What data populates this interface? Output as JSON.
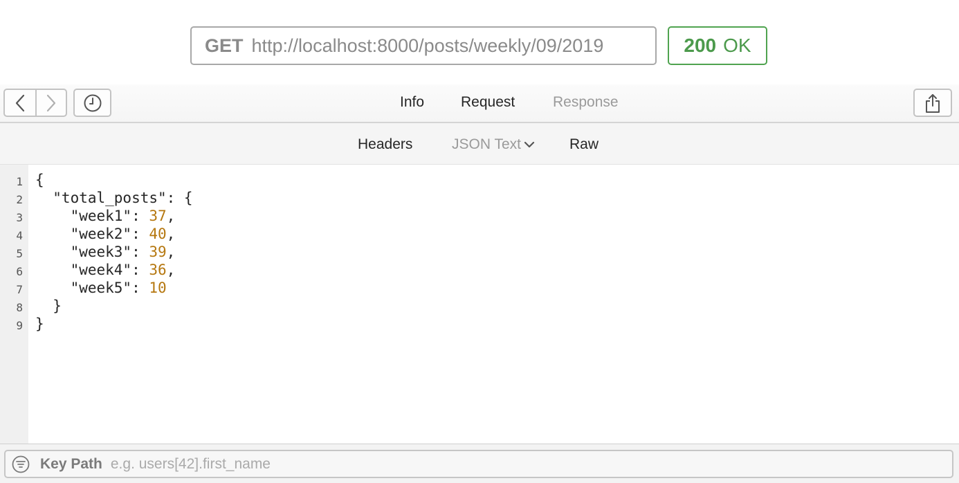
{
  "request": {
    "method": "GET",
    "url": "http://localhost:8000/posts/weekly/09/2019"
  },
  "status": {
    "code": "200",
    "text": "OK",
    "color": "#4c9a4c"
  },
  "toolbar": {
    "back_icon": "chevron-left-icon",
    "forward_icon": "chevron-right-icon",
    "history_icon": "clock-icon",
    "share_icon": "share-icon",
    "tabs": [
      {
        "label": "Info",
        "active": false
      },
      {
        "label": "Request",
        "active": false
      },
      {
        "label": "Response",
        "active": true
      }
    ]
  },
  "subtabs": [
    {
      "label": "Headers"
    },
    {
      "label": "JSON Text",
      "selected": true
    },
    {
      "label": "Raw"
    }
  ],
  "editor": {
    "lines": [
      {
        "no": "1",
        "text": "{"
      },
      {
        "no": "2",
        "text": "  \"total_posts\": {"
      },
      {
        "no": "3",
        "key": "    \"week1\": ",
        "value": "37",
        "suffix": ","
      },
      {
        "no": "4",
        "key": "    \"week2\": ",
        "value": "40",
        "suffix": ","
      },
      {
        "no": "5",
        "key": "    \"week3\": ",
        "value": "39",
        "suffix": ","
      },
      {
        "no": "6",
        "key": "    \"week4\": ",
        "value": "36",
        "suffix": ","
      },
      {
        "no": "7",
        "key": "    \"week5\": ",
        "value": "10",
        "suffix": ""
      },
      {
        "no": "8",
        "text": "  }"
      },
      {
        "no": "9",
        "text": "}"
      }
    ]
  },
  "footer": {
    "filter_icon": "filter-icon",
    "label": "Key Path",
    "placeholder": "e.g. users[42].first_name"
  }
}
